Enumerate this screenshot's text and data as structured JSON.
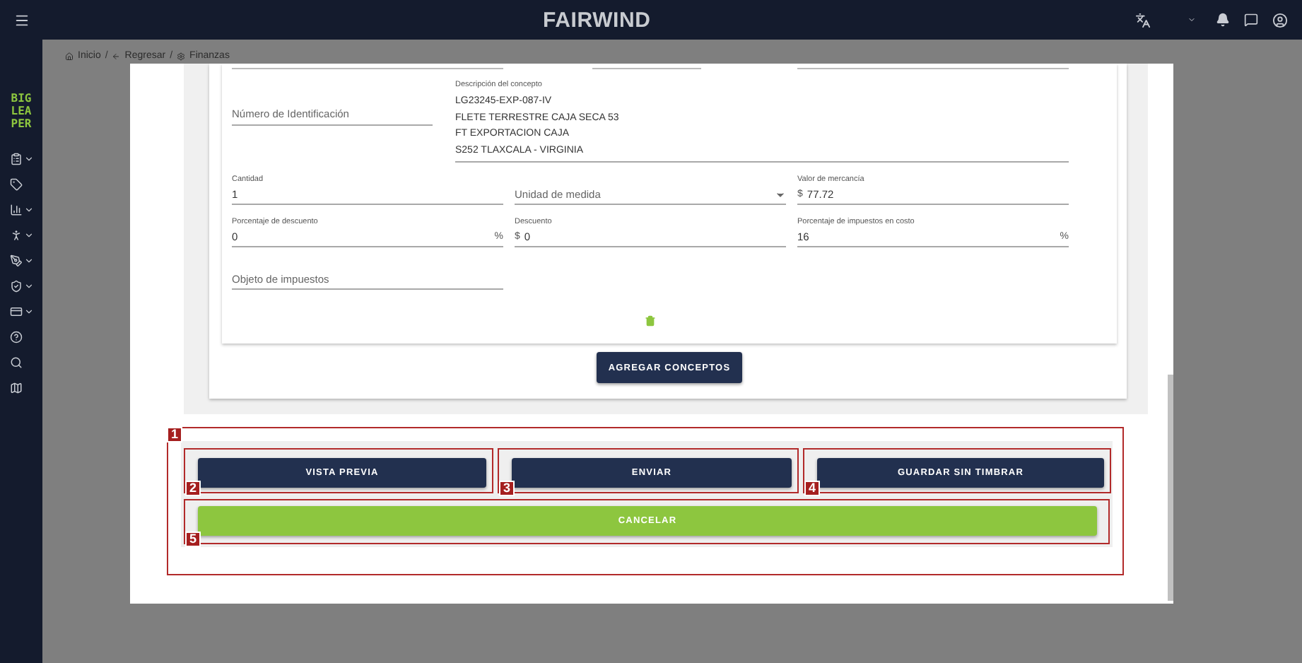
{
  "header": {
    "title": "FAIRWIND"
  },
  "sidebar": {
    "logo_lines": [
      "BIG",
      "LEA",
      "PER"
    ],
    "items": [
      {
        "expandable": true
      },
      {
        "expandable": false
      },
      {
        "expandable": true
      },
      {
        "expandable": true
      },
      {
        "expandable": true
      },
      {
        "expandable": true
      },
      {
        "expandable": true
      },
      {
        "expandable": false
      },
      {
        "expandable": false
      },
      {
        "expandable": false
      }
    ]
  },
  "breadcrumb": {
    "separator": "/",
    "items": [
      "Inicio",
      "Regresar",
      "Finanzas"
    ]
  },
  "concept_form": {
    "identification": {
      "placeholder": "Número de Identificación"
    },
    "description": {
      "label": "Descripción del concepto",
      "lines": [
        "LG23245-EXP-087-IV",
        "FLETE TERRESTRE CAJA SECA 53",
        "FT EXPORTACION CAJA",
        "S252 TLAXCALA - VIRGINIA"
      ]
    },
    "fields": [
      {
        "kind": "text",
        "label": "Cantidad",
        "value": "1"
      },
      {
        "kind": "select",
        "placeholder": "Unidad de medida"
      },
      {
        "kind": "text",
        "label": "Valor de mercancía",
        "prefix": "$",
        "value": "77.72"
      },
      {
        "kind": "text",
        "label": "Porcentaje de descuento",
        "value": "0",
        "suffix": "%"
      },
      {
        "kind": "text",
        "label": "Descuento",
        "prefix": "$",
        "value": "0"
      },
      {
        "kind": "text",
        "label": "Porcentaje de impuestos en costo",
        "value": "16",
        "suffix": "%"
      },
      {
        "kind": "text",
        "placeholder": "Objeto de impuestos"
      }
    ],
    "add_button": "AGREGAR CONCEPTOS"
  },
  "callout_group": {
    "number": "1",
    "actions": [
      {
        "label": "VISTA PREVIA",
        "number": "2",
        "kind": "primary"
      },
      {
        "label": "ENVIAR",
        "number": "3",
        "kind": "primary"
      },
      {
        "label": "GUARDAR SIN TIMBRAR",
        "number": "4",
        "kind": "primary"
      }
    ],
    "cancel": {
      "label": "CANCELAR",
      "number": "5",
      "kind": "cancel"
    }
  }
}
